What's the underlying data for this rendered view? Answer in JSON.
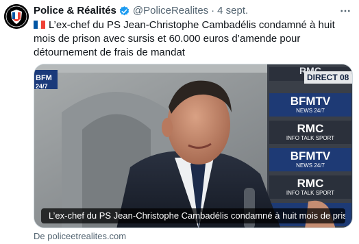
{
  "tweet": {
    "display_name": "Police & Réalités",
    "handle": "@PoliceRealites",
    "separator": "·",
    "date": "4 sept.",
    "more_icon": "more-icon",
    "verified_color": "#1d9bf0",
    "text": "L’ex-chef du PS Jean-Christophe Cambadélis condamné à huit mois de prison avec sursis et 60.000 euros d’amende pour détournement de frais de mandat"
  },
  "media": {
    "overlay_texts": {
      "direct": "DIRECT 08",
      "rmc": "RMC",
      "rmc_sub": "INFO TALK SPORT",
      "bfm": "BFMTV",
      "bfm_sub": "NEWS 24/7",
      "bfm_corner": "BFM",
      "bfm_corner_sub": "24/7"
    },
    "caption": "L’ex-chef du PS Jean-Christophe Cambadélis condamné à huit mois de pris..."
  },
  "card": {
    "source": "De policeetrealites.com"
  },
  "colors": {
    "flag_blue": "#0055a4",
    "flag_white": "#ffffff",
    "flag_red": "#ef4135",
    "bfm_blue": "#1b3a7a",
    "rmc_dark": "#2a2f3a"
  }
}
